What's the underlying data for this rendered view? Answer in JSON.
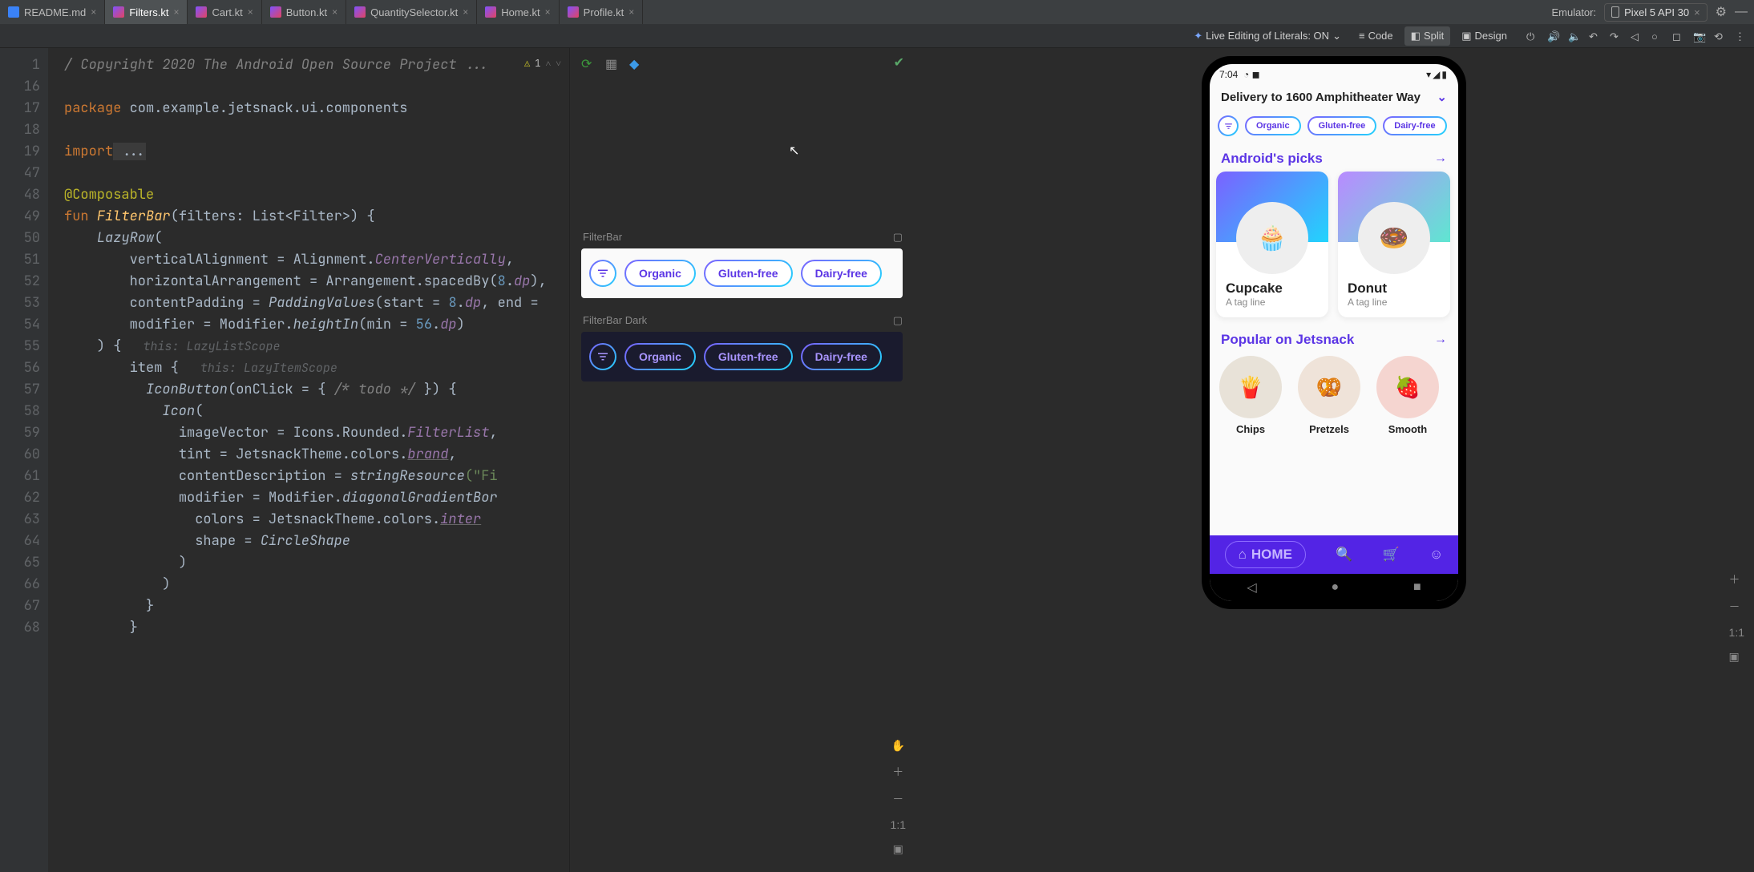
{
  "tabs": [
    {
      "label": "README.md",
      "type": "md"
    },
    {
      "label": "Filters.kt",
      "type": "kt",
      "active": true
    },
    {
      "label": "Cart.kt",
      "type": "kt"
    },
    {
      "label": "Button.kt",
      "type": "kt"
    },
    {
      "label": "QuantitySelector.kt",
      "type": "kt"
    },
    {
      "label": "Home.kt",
      "type": "kt"
    },
    {
      "label": "Profile.kt",
      "type": "kt"
    }
  ],
  "emulator": {
    "label": "Emulator:",
    "device": "Pixel 5 API 30"
  },
  "toolbar": {
    "live_edit": "Live Editing of Literals: ON",
    "code": "Code",
    "split": "Split",
    "design": "Design"
  },
  "gutter": [
    "1",
    "16",
    "17",
    "18",
    "19",
    "47",
    "48",
    "49",
    "50",
    "51",
    "52",
    "53",
    "54",
    "55",
    "56",
    "57",
    "58",
    "59",
    "60",
    "61",
    "62",
    "63",
    "64",
    "65",
    "66",
    "67",
    "68"
  ],
  "code_status": {
    "warn_count": "1"
  },
  "code": {
    "l1a": "/ Copyright 2020 The Android Open Source Project ...",
    "l3_kw": "package",
    "l3_rest": " com.example.jetsnack.ui.components",
    "l5_kw": "import",
    "l5_rest": " ...",
    "l7": "@Composable",
    "l8_kw": "fun ",
    "l8_fn": "FilterBar",
    "l8_rest": "(filters: List<Filter>) {",
    "l9_it": "LazyRow",
    "l9_rest": "(",
    "l10_p": "verticalAlignment = Alignment.",
    "l10_c": "CenterVertically",
    "l10_e": ",",
    "l11_p": "horizontalArrangement = Arrangement.spacedBy(",
    "l11_n": "8",
    "l11_d": ".",
    "l11_u": "dp",
    "l11_e": "),",
    "l12_p": "contentPadding = ",
    "l12_it": "PaddingValues",
    "l12_r": "(start = ",
    "l12_n1": "8",
    "l12_d1": ".",
    "l12_u1": "dp",
    "l12_r2": ", end = ",
    "l13_p": "modifier = Modifier.",
    "l13_it": "heightIn",
    "l13_r": "(min = ",
    "l13_n": "56",
    "l13_d": ".",
    "l13_u": "dp",
    "l13_e": ")",
    "l14": ") {",
    "l14_hint": "this: LazyListScope",
    "l15": "item {",
    "l15_hint": "this: LazyItemScope",
    "l16_it": "IconButton",
    "l16_r": "(onClick = { ",
    "l16_c": "/* todo */",
    "l16_e": " }) {",
    "l17_it": "Icon",
    "l17_r": "(",
    "l18_p": "imageVector = Icons.Rounded.",
    "l18_v": "FilterList",
    "l18_e": ",",
    "l19_p": "tint = JetsnackTheme.colors.",
    "l19_v": "brand",
    "l19_e": ",",
    "l20_p": "contentDescription = ",
    "l20_it": "stringResource",
    "l20_r": "(\"Fi",
    "l21_p": "modifier = Modifier.",
    "l21_it": "diagonalGradientBor",
    "l22_p": "colors = JetsnackTheme.colors.",
    "l22_v": "inter",
    "l23_p": "shape = ",
    "l23_v": "CircleShape",
    "l24": ")",
    "l25": ")",
    "l26": "}",
    "l27": "}"
  },
  "preview": {
    "light_label": "FilterBar",
    "dark_label": "FilterBar Dark",
    "chips": [
      "Organic",
      "Gluten-free",
      "Dairy-free"
    ]
  },
  "preview_controls": {
    "oneToOne": "1:1"
  },
  "phone": {
    "time": "7:04",
    "address": "Delivery to 1600 Amphitheater Way",
    "chips": [
      "Organic",
      "Gluten-free",
      "Dairy-free"
    ],
    "section1": "Android's picks",
    "cards": [
      {
        "name": "Cupcake",
        "tag": "A tag line",
        "emoji": "🧁"
      },
      {
        "name": "Donut",
        "tag": "A tag line",
        "emoji": "🍩"
      }
    ],
    "section2": "Popular on Jetsnack",
    "popular": [
      {
        "name": "Chips",
        "emoji": "🍟"
      },
      {
        "name": "Pretzels",
        "emoji": "🥨"
      },
      {
        "name": "Smooth",
        "emoji": "🍓"
      }
    ],
    "home": "HOME"
  }
}
